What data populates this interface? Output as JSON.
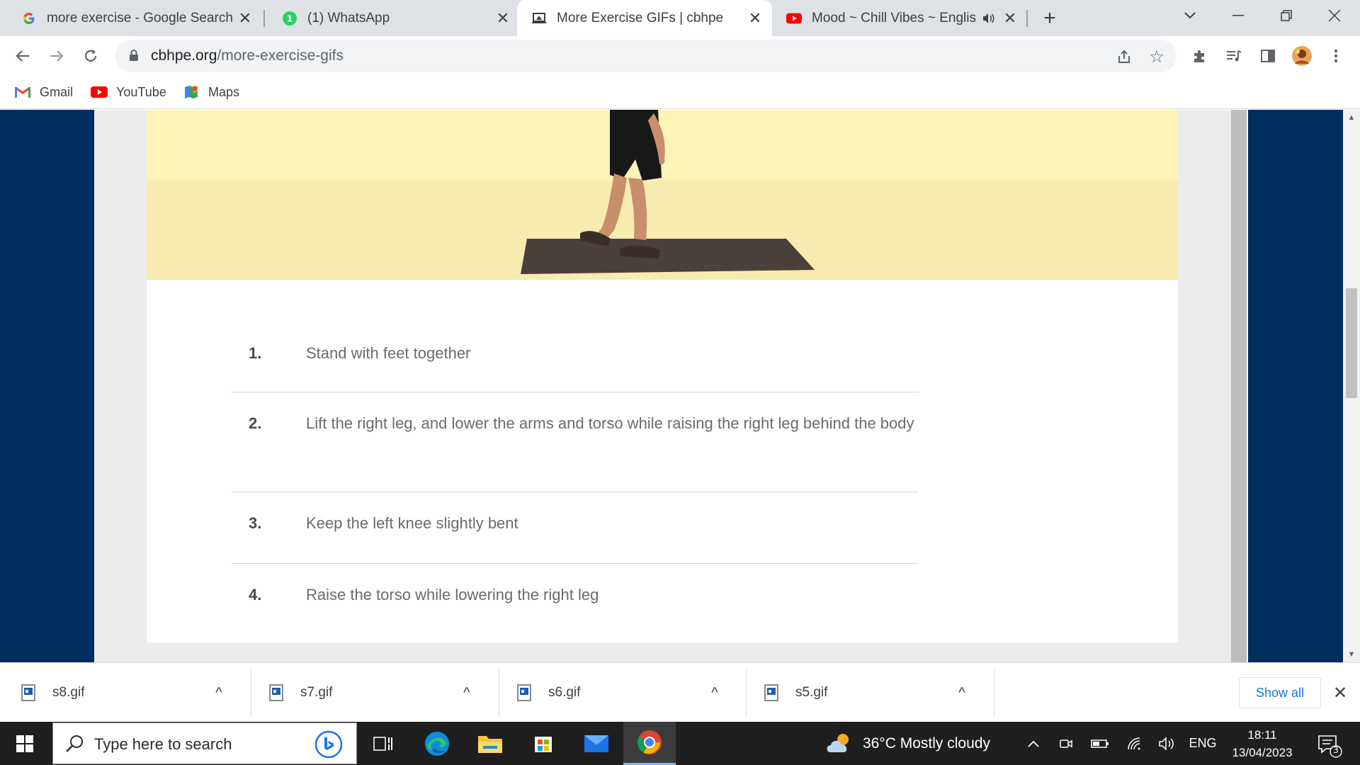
{
  "tabs": [
    {
      "title": "more exercise - Google Search",
      "favicon": "google-icon",
      "active": false
    },
    {
      "title": "(1) WhatsApp",
      "favicon": "whatsapp-icon",
      "badge": "1",
      "active": false
    },
    {
      "title": "More Exercise GIFs | cbhpe",
      "favicon": "laptop-icon",
      "active": true
    },
    {
      "title": "Mood ~ Chill Vibes ~ Englis",
      "favicon": "youtube-icon",
      "active": false
    }
  ],
  "address": {
    "domain": "cbhpe.org",
    "path": "/more-exercise-gifs"
  },
  "bookmarks": [
    {
      "label": "Gmail",
      "icon": "gmail-icon"
    },
    {
      "label": "YouTube",
      "icon": "youtube-icon"
    },
    {
      "label": "Maps",
      "icon": "maps-icon"
    }
  ],
  "steps": [
    {
      "num": "1.",
      "text": "Stand with feet together"
    },
    {
      "num": "2.",
      "text": "Lift the right leg, and lower the arms and torso while raising the right leg behind the body"
    },
    {
      "num": "3.",
      "text": "Keep the left knee slightly bent"
    },
    {
      "num": "4.",
      "text": "Raise the torso while lowering the right leg"
    }
  ],
  "downloads": [
    {
      "name": "s8.gif"
    },
    {
      "name": "s7.gif"
    },
    {
      "name": "s6.gif"
    },
    {
      "name": "s5.gif"
    }
  ],
  "download_bar": {
    "show_all": "Show all"
  },
  "taskbar": {
    "search_placeholder": "Type here to search",
    "weather": "36°C  Mostly cloudy",
    "lang": "ENG",
    "time": "18:11",
    "date": "13/04/2023",
    "notifications": "3"
  },
  "colors": {
    "sidebar_blue": "#002f5f",
    "gif_background": "#fcf0b8",
    "link_blue": "#1a73e8"
  }
}
